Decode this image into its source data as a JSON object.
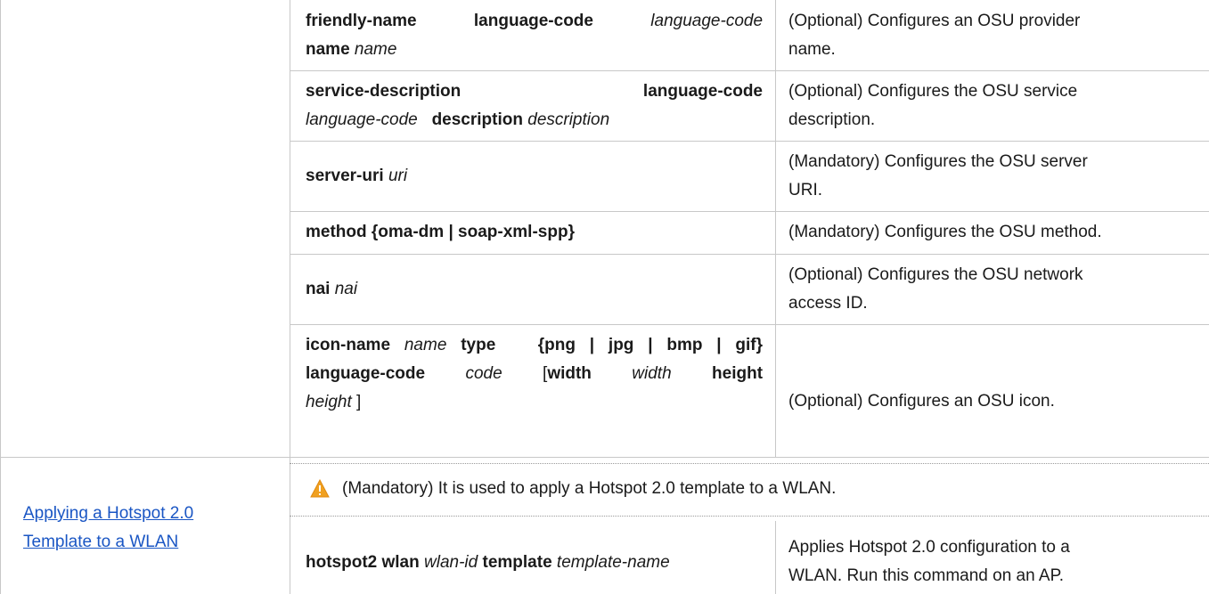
{
  "table": {
    "rows": [
      {
        "cmd_lines": [
          [
            {
              "t": "friendly-name",
              "s": "b"
            },
            {
              "t": "language-code",
              "s": "b"
            },
            {
              "t": "language-code",
              "s": "i"
            }
          ],
          [
            {
              "t": "name",
              "s": "b"
            },
            {
              "t": "name",
              "s": "i"
            }
          ]
        ],
        "desc_lines": [
          "(Optional) Configures an OSU provider",
          "name."
        ]
      },
      {
        "cmd_lines": [
          [
            {
              "t": "service-description",
              "s": "b"
            },
            {
              "t": "language-code",
              "s": "b"
            }
          ],
          [
            {
              "t": "language-code",
              "s": "i"
            },
            {
              "t": "description",
              "s": "b"
            },
            {
              "t": "description",
              "s": "i"
            }
          ]
        ],
        "desc_lines": [
          "(Optional) Configures the OSU service",
          "description."
        ]
      },
      {
        "cmd_lines": [
          [
            {
              "t": "server-uri",
              "s": "b"
            },
            {
              "t": "uri",
              "s": "i"
            }
          ]
        ],
        "desc_lines": [
          "(Mandatory) Configures the OSU server",
          "URI."
        ]
      },
      {
        "cmd_lines": [
          [
            {
              "t": "method {oma-dm | soap-xml-spp}",
              "s": "b"
            }
          ]
        ],
        "desc_lines": [
          "(Mandatory) Configures the OSU method."
        ]
      },
      {
        "cmd_lines": [
          [
            {
              "t": "nai",
              "s": "b"
            },
            {
              "t": "nai",
              "s": "i"
            }
          ]
        ],
        "desc_lines": [
          "(Optional) Configures the OSU network",
          "access ID."
        ]
      },
      {
        "cmd_lines": [
          [
            {
              "t": "icon-name",
              "s": "b"
            },
            {
              "t": "name",
              "s": "i"
            },
            {
              "t": "type",
              "s": "b"
            },
            {
              "t": "{png | jpg | bmp | gif}",
              "s": "b"
            }
          ],
          [
            {
              "t": "language-code",
              "s": "b"
            },
            {
              "t": "code",
              "s": "i"
            },
            {
              "t": "[",
              "s": "n"
            },
            {
              "t": "width",
              "s": "b"
            },
            {
              "t": "width",
              "s": "i"
            },
            {
              "t": "height",
              "s": "b"
            }
          ],
          [
            {
              "t": "height",
              "s": "i"
            },
            {
              "t": " ]",
              "s": "n"
            }
          ]
        ],
        "desc_lines": [
          "(Optional) Configures an OSU icon."
        ]
      }
    ],
    "section": {
      "link_line1": "Applying a Hotspot 2.0 ",
      "link_line2": "Template to a WLAN",
      "note_icon": "warning-triangle-icon",
      "note_text": "(Mandatory) It is used to apply a Hotspot 2.0 template to a WLAN.",
      "cmd": [
        {
          "t": "hotspot2 wlan",
          "s": "b"
        },
        {
          "t": "wlan-id",
          "s": "i"
        },
        {
          "t": "template",
          "s": "b"
        },
        {
          "t": "template-name",
          "s": "i"
        }
      ],
      "desc_lines": [
        "Applies Hotspot 2.0 configuration to a",
        "WLAN. Run this command on an AP."
      ]
    }
  },
  "colors": {
    "border": "#c8c8c8",
    "link": "#1a56c4",
    "warning": "#f0a020"
  }
}
